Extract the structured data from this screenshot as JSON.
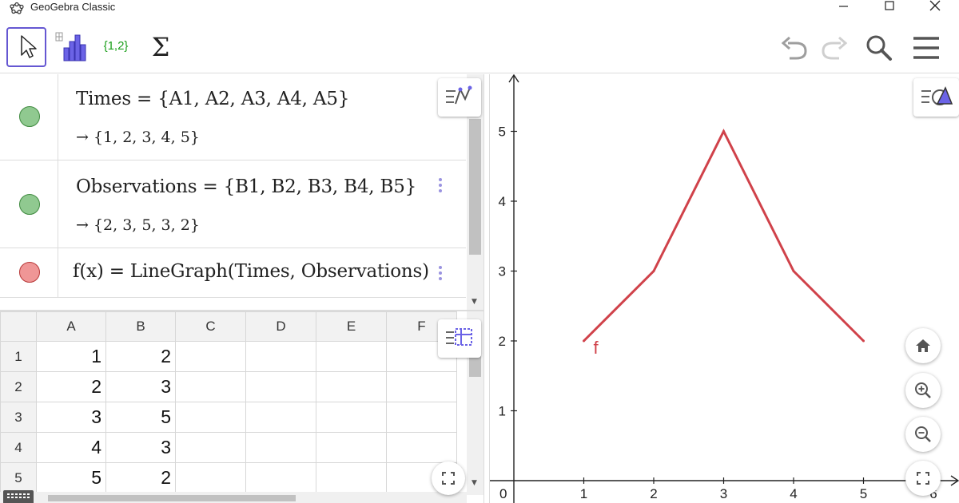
{
  "window": {
    "title": "GeoGebra Classic",
    "icons": [
      "geogebra-logo-icon",
      "minimize-icon",
      "maximize-icon",
      "close-icon"
    ]
  },
  "toolbar": {
    "tools": [
      {
        "name": "move",
        "icon": "cursor-arrow-icon",
        "selected": true
      },
      {
        "name": "analysis",
        "icon": "spreadsheet-chart-icon"
      },
      {
        "name": "list",
        "label": "{1,2}"
      },
      {
        "name": "sum",
        "label": "Σ"
      }
    ],
    "right_icons": [
      "undo-icon",
      "redo-icon",
      "search-icon",
      "menu-icon"
    ],
    "accent_color": "#6557d2"
  },
  "algebra": {
    "rows": [
      {
        "definition": "Times = {A1, A2, A3, A4, A5}",
        "value": "→ {1,  2,  3,  4,  5}",
        "marble_color": "green"
      },
      {
        "definition": "Observations = {B1, B2, B3, B4, B5}",
        "value": "→ {2,  3,  5,  3,  2}",
        "marble_color": "green"
      },
      {
        "definition": "f(x)  =  LineGraph(Times, Observations)",
        "marble_color": "red"
      }
    ]
  },
  "spreadsheet": {
    "columns": [
      "A",
      "B",
      "C",
      "D",
      "E",
      "F"
    ],
    "rows": [
      {
        "row": "1",
        "A": "1",
        "B": "2"
      },
      {
        "row": "2",
        "A": "2",
        "B": "3"
      },
      {
        "row": "3",
        "A": "3",
        "B": "5"
      },
      {
        "row": "4",
        "A": "4",
        "B": "3"
      },
      {
        "row": "5",
        "A": "5",
        "B": "2"
      }
    ]
  },
  "graphics": {
    "curve_label": "f",
    "curve_color": "#d0424a",
    "buttons": [
      "home-icon",
      "zoom-in-icon",
      "zoom-out-icon",
      "fullscreen-icon"
    ]
  },
  "chart_data": {
    "type": "line",
    "x": [
      1,
      2,
      3,
      4,
      5
    ],
    "series": [
      {
        "name": "f",
        "values": [
          2,
          3,
          5,
          3,
          2
        ]
      }
    ],
    "xlim": [
      0,
      6
    ],
    "ylim": [
      0,
      5
    ],
    "x_ticks": [
      "0",
      "1",
      "2",
      "3",
      "4",
      "5",
      "6"
    ],
    "y_ticks": [
      "1",
      "2",
      "3",
      "4",
      "5"
    ],
    "grid": false
  }
}
